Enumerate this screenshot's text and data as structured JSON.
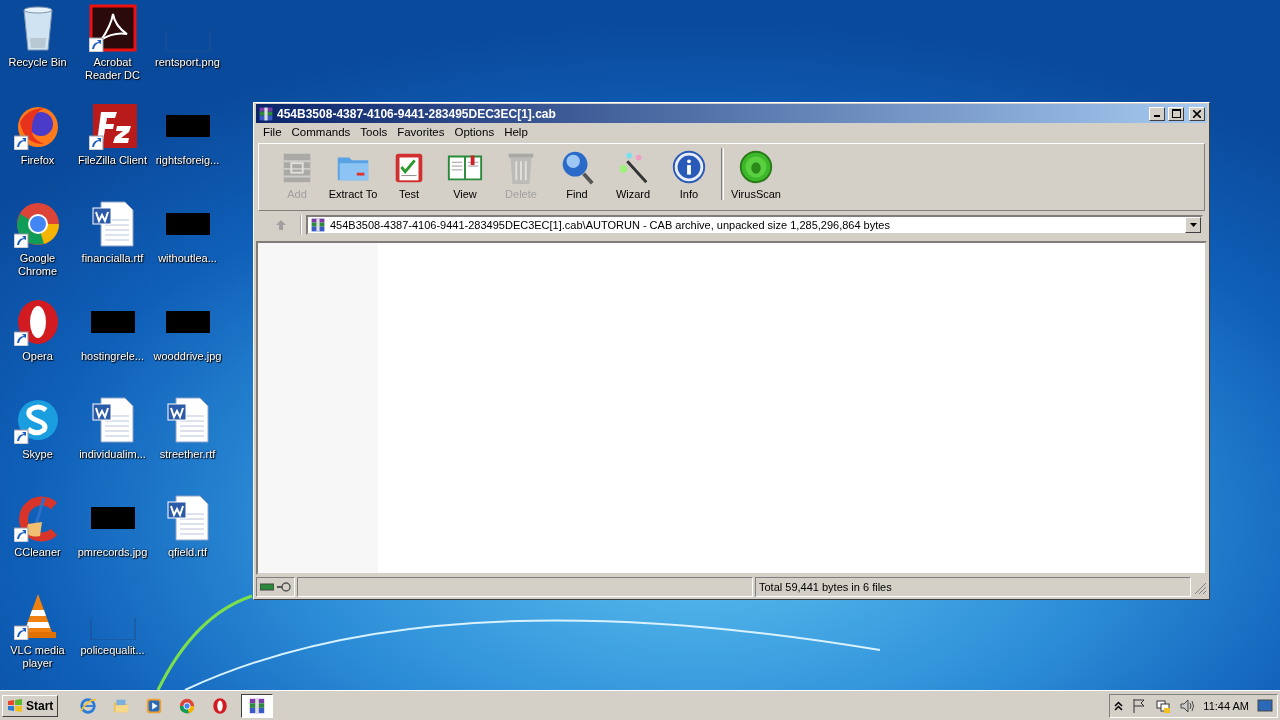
{
  "desktop": {
    "icons": [
      {
        "label": "Recycle Bin",
        "kind": "recycle",
        "shortcut": false
      },
      {
        "label": "Firefox",
        "kind": "firefox",
        "shortcut": true
      },
      {
        "label": "Google Chrome",
        "kind": "chrome",
        "shortcut": true
      },
      {
        "label": "Opera",
        "kind": "opera",
        "shortcut": true
      },
      {
        "label": "Skype",
        "kind": "skype",
        "shortcut": true
      },
      {
        "label": "CCleaner",
        "kind": "ccleaner",
        "shortcut": true
      },
      {
        "label": "VLC media player",
        "kind": "vlc",
        "shortcut": true
      },
      {
        "label": "Acrobat Reader DC",
        "kind": "acrobat",
        "shortcut": true
      },
      {
        "label": "FileZilla Client",
        "kind": "filezilla",
        "shortcut": true
      },
      {
        "label": "financialla.rtf",
        "kind": "word",
        "shortcut": false
      },
      {
        "label": "hostingrele...",
        "kind": "thumb-dark",
        "shortcut": false
      },
      {
        "label": "individualim...",
        "kind": "word",
        "shortcut": false
      },
      {
        "label": "pmrecords.jpg",
        "kind": "thumb-dark",
        "shortcut": false
      },
      {
        "label": "policequalit...",
        "kind": "thumb-blank",
        "shortcut": false
      },
      {
        "label": "rentsport.png",
        "kind": "thumb-blank",
        "shortcut": false
      },
      {
        "label": "rightsforeig...",
        "kind": "thumb-dark",
        "shortcut": false
      },
      {
        "label": "withoutlea...",
        "kind": "thumb-dark",
        "shortcut": false
      },
      {
        "label": "wooddrive.jpg",
        "kind": "thumb-dark",
        "shortcut": false
      },
      {
        "label": "streether.rtf",
        "kind": "word",
        "shortcut": false
      },
      {
        "label": "qfield.rtf",
        "kind": "word",
        "shortcut": false
      }
    ]
  },
  "window": {
    "title": "454B3508-4387-4106-9441-283495DEC3EC[1].cab",
    "menu": [
      "File",
      "Commands",
      "Tools",
      "Favorites",
      "Options",
      "Help"
    ],
    "toolbar": [
      {
        "label": "Add",
        "kind": "add",
        "disabled": true
      },
      {
        "label": "Extract To",
        "kind": "extract",
        "disabled": false
      },
      {
        "label": "Test",
        "kind": "test",
        "disabled": false
      },
      {
        "label": "View",
        "kind": "view",
        "disabled": false
      },
      {
        "label": "Delete",
        "kind": "delete",
        "disabled": true
      },
      {
        "label": "Find",
        "kind": "find",
        "disabled": false
      },
      {
        "label": "Wizard",
        "kind": "wizard",
        "disabled": false
      },
      {
        "label": "Info",
        "kind": "info",
        "disabled": false
      }
    ],
    "toolbar_extra": [
      {
        "label": "VirusScan",
        "kind": "virus",
        "disabled": false
      }
    ],
    "address": "454B3508-4387-4106-9441-283495DEC3EC[1].cab\\AUTORUN - CAB archive, unpacked size 1,285,296,864 bytes",
    "status": "Total 59,441 bytes in 6 files"
  },
  "taskbar": {
    "start": "Start",
    "apps": [
      {
        "kind": "ie",
        "selected": false
      },
      {
        "kind": "explorer",
        "selected": false
      },
      {
        "kind": "media",
        "selected": false
      },
      {
        "kind": "chrome",
        "selected": false
      },
      {
        "kind": "opera",
        "selected": false
      },
      {
        "kind": "winrar",
        "selected": true
      }
    ],
    "clock": "11:44 AM"
  }
}
